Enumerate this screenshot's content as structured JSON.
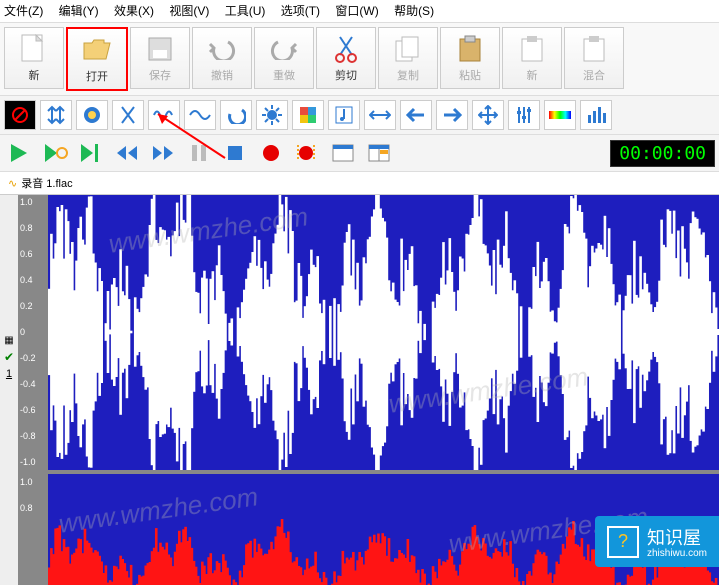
{
  "menu": {
    "file": "文件(Z)",
    "edit": "编辑(Y)",
    "effects": "效果(X)",
    "view": "视图(V)",
    "tools": "工具(U)",
    "options": "选项(T)",
    "window": "窗口(W)",
    "help": "帮助(S)"
  },
  "toolbar1": {
    "new": "新",
    "open": "打开",
    "save": "保存",
    "undo": "撤销",
    "redo": "重做",
    "cut": "剪切",
    "copy": "复制",
    "paste": "粘贴",
    "newwin": "新",
    "mix": "混合"
  },
  "file_tab": "录音 1.flac",
  "timecode": "00:00:00",
  "ruler_ticks": [
    "1.0",
    "0.8",
    "0.6",
    "0.4",
    "0.2",
    "0",
    "-0.2",
    "-0.4",
    "-0.6",
    "-0.8",
    "-1.0",
    "1.0",
    "0.8"
  ],
  "track_number": "1",
  "watermarks": [
    "www.wmzhe.com",
    "www.wmzhe.com",
    "www.wmzhe.com",
    "www.wmzhe.com"
  ],
  "badge": {
    "title": "知识屋",
    "url": "zhishiwu.com",
    "icon": "?"
  }
}
